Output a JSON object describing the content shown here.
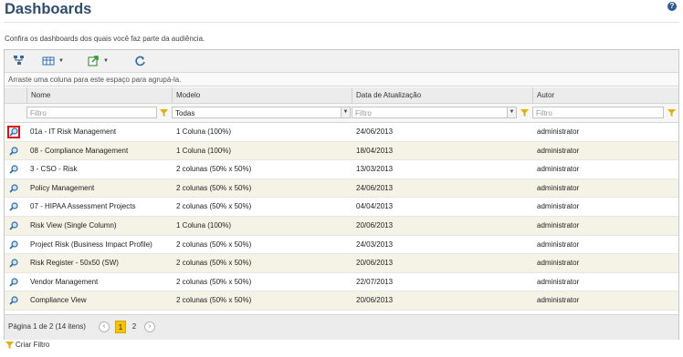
{
  "page": {
    "title": "Dashboards",
    "subtitle": "Confira os dashboards dos quais você faz parte da audiência.",
    "help_icon": "?"
  },
  "toolbar": {
    "icons": [
      "tree-icon",
      "columns-icon",
      "export-icon",
      "refresh-icon"
    ]
  },
  "groupbar": {
    "text": "Arraste uma coluna para este espaço para agrupá-la."
  },
  "columns": {
    "nome": "Nome",
    "modelo": "Modelo",
    "data": "Data de Atualização",
    "autor": "Autor"
  },
  "filters": {
    "nome_placeholder": "Filtro",
    "modelo_value": "Todas",
    "data_placeholder": "Filtro",
    "autor_placeholder": "Filtro"
  },
  "rows": [
    {
      "nome": "01a - IT Risk Management",
      "modelo": "1 Coluna (100%)",
      "data": "24/06/2013",
      "autor": "administrator"
    },
    {
      "nome": "08 - Compliance Management",
      "modelo": "1 Coluna (100%)",
      "data": "18/04/2013",
      "autor": "administrator"
    },
    {
      "nome": "3 - CSO - Risk",
      "modelo": "2 colunas (50% x 50%)",
      "data": "13/03/2013",
      "autor": "administrator"
    },
    {
      "nome": "Policy Management",
      "modelo": "2 colunas (50% x 50%)",
      "data": "24/06/2013",
      "autor": "administrator"
    },
    {
      "nome": "07 - HIPAA Assessment Projects",
      "modelo": "2 colunas (50% x 50%)",
      "data": "04/04/2013",
      "autor": "administrator"
    },
    {
      "nome": "Risk View (Single Column)",
      "modelo": "1 Coluna (100%)",
      "data": "20/06/2013",
      "autor": "administrator"
    },
    {
      "nome": "Project Risk (Business Impact Profile)",
      "modelo": "2 colunas (50% x 50%)",
      "data": "24/03/2013",
      "autor": "administrator"
    },
    {
      "nome": "Risk Register - 50x50 (SW)",
      "modelo": "2 colunas (50% x 50%)",
      "data": "20/06/2013",
      "autor": "administrator"
    },
    {
      "nome": "Vendor Management",
      "modelo": "2 colunas (50% x 50%)",
      "data": "22/07/2013",
      "autor": "administrator"
    },
    {
      "nome": "Compliance View",
      "modelo": "2 colunas (50% x 50%)",
      "data": "20/06/2013",
      "autor": "administrator"
    }
  ],
  "pager": {
    "text": "Página 1 de 2 (14 itens)",
    "prev": "‹",
    "page1": "1",
    "page2": "2",
    "next": "›"
  },
  "footer": {
    "create_filter": "Criar Filtro"
  },
  "colors": {
    "title": "#2f4e6f",
    "alt_row": "#f5f3e6",
    "current_page": "#f5c400",
    "selection": "#dd1111"
  }
}
